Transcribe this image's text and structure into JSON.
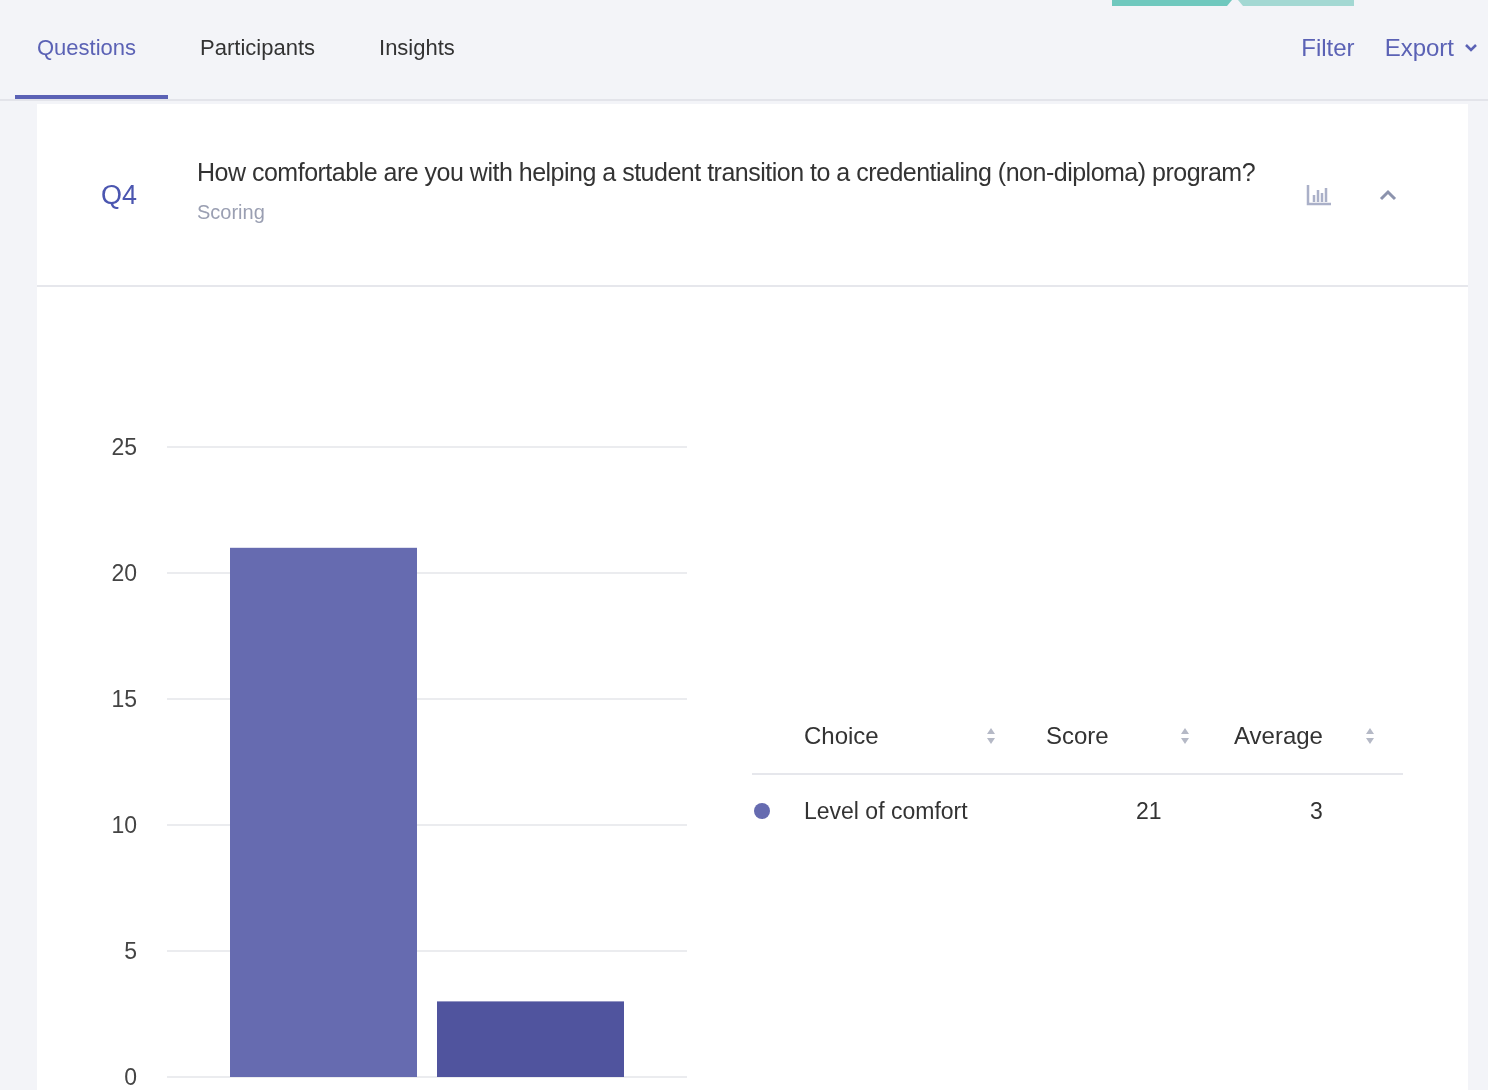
{
  "tabs": [
    {
      "label": "Questions",
      "selected": true
    },
    {
      "label": "Participants",
      "selected": false
    },
    {
      "label": "Insights",
      "selected": false
    }
  ],
  "actions": {
    "filter": "Filter",
    "export": "Export"
  },
  "question": {
    "number": "Q4",
    "title": "How comfortable are you with helping a student transition to a credentialing (non-diploma) program?",
    "type": "Scoring",
    "expanded": true
  },
  "chart_data": {
    "type": "bar",
    "grid": true,
    "ylim": [
      0,
      25
    ],
    "yticks": [
      0,
      5,
      10,
      15,
      20,
      25
    ],
    "series": [
      {
        "color": "#666bb0",
        "values": [
          21,
          null
        ]
      },
      {
        "color": "#50549e",
        "values": [
          null,
          3
        ]
      }
    ]
  },
  "table": {
    "columns": [
      "Choice",
      "Score",
      "Average"
    ],
    "rows": [
      {
        "color": "#666bb0",
        "choice": "Level of comfort",
        "score": "21",
        "average": "3"
      }
    ]
  }
}
